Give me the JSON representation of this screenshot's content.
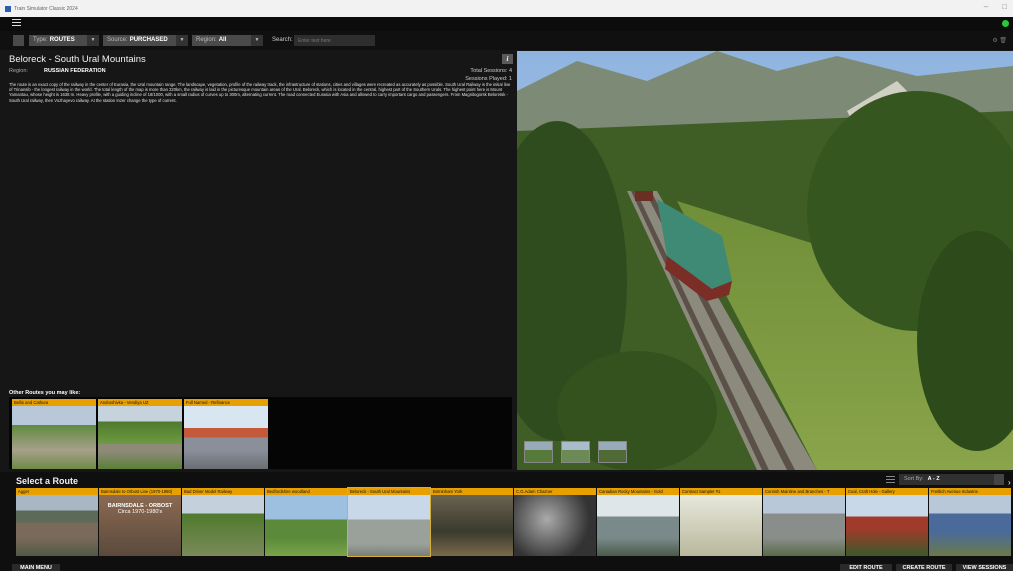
{
  "window": {
    "title": "Train Simulator Classic 2024"
  },
  "filters": {
    "type": {
      "label": "Type:",
      "value": "ROUTES"
    },
    "source": {
      "label": "Source:",
      "value": "PURCHASED"
    },
    "region": {
      "label": "Region:",
      "value": "All"
    },
    "search": {
      "label": "Search:",
      "placeholder": "Enter text here"
    }
  },
  "route": {
    "title": "Beloreck - South Ural Mountains",
    "region_label": "Region:",
    "region_value": "RUSSIAN FEDERATION",
    "total_sessions": "Total Sessions: 4",
    "sessions_played": "Sessions Played: 1",
    "description": "The route is an exact copy of the railway in the center of Eurasia, the Ural mountain range. The landscape, vegetation, profile of the railway track, the infrastructure of stations, cities and villages were recreated as accurately as possible. South Ural Railway is the initial line of Trinansib - the longest railway in the world. The total length of the map is more than 220km, the railway is laid in the picturesque mountain areas of the Ural. Beloreck, which is located in the central, highest part of the Southern Urals. The highest point here is Mount Yamantau, whose height is 1638 m. Heavy profile, with a guiding incline of 18/1000, with a small radius of curves up to 300m, alternating current. The road connected Eurasia with Asia and allowed to carry important cargo and passengers. From Magnitogorsk Beloretsk - South Ural railway, then Vozhayevo railway. At the station Inzer change the type of current."
  },
  "other_routes": {
    "heading": "Other Routes you may like:",
    "items": [
      {
        "label": "Bellis and Cathura"
      },
      {
        "label": "Andrushivka - Vendiya UZ"
      },
      {
        "label": "Full Named - Refinance"
      }
    ]
  },
  "route_list": {
    "heading": "Select a Route",
    "sort_label": "Sort By:",
    "sort_value": "A - Z",
    "items": [
      {
        "label": "Agger"
      },
      {
        "label": "Bairnsdale to Orbost Line (1970-1980)",
        "overlay_line1": "BAIRNSDALE - ORBOST",
        "overlay_line2": "Circa 1970-1980's"
      },
      {
        "label": "Bad Driver Model Railway"
      },
      {
        "label": "Bedfordshire woodland"
      },
      {
        "label": "Beloreck - South Ural Mountains"
      },
      {
        "label": "Birminham York"
      },
      {
        "label": "C.G.Adam Chazner"
      },
      {
        "label": "Canadian Rocky Mountains - Gold"
      },
      {
        "label": "Contract Sampler #1"
      },
      {
        "label": "Cornish Mainline and Branches - T"
      },
      {
        "label": "Coal, Craft Hole - Gallery"
      },
      {
        "label": "Freitlich Avenue Industrie"
      }
    ]
  },
  "buttons": {
    "main_menu": "MAIN MENU",
    "edit_route": "EDIT ROUTE",
    "create_route": "CREATE ROUTE",
    "view_sessions": "VIEW SESSIONS"
  }
}
